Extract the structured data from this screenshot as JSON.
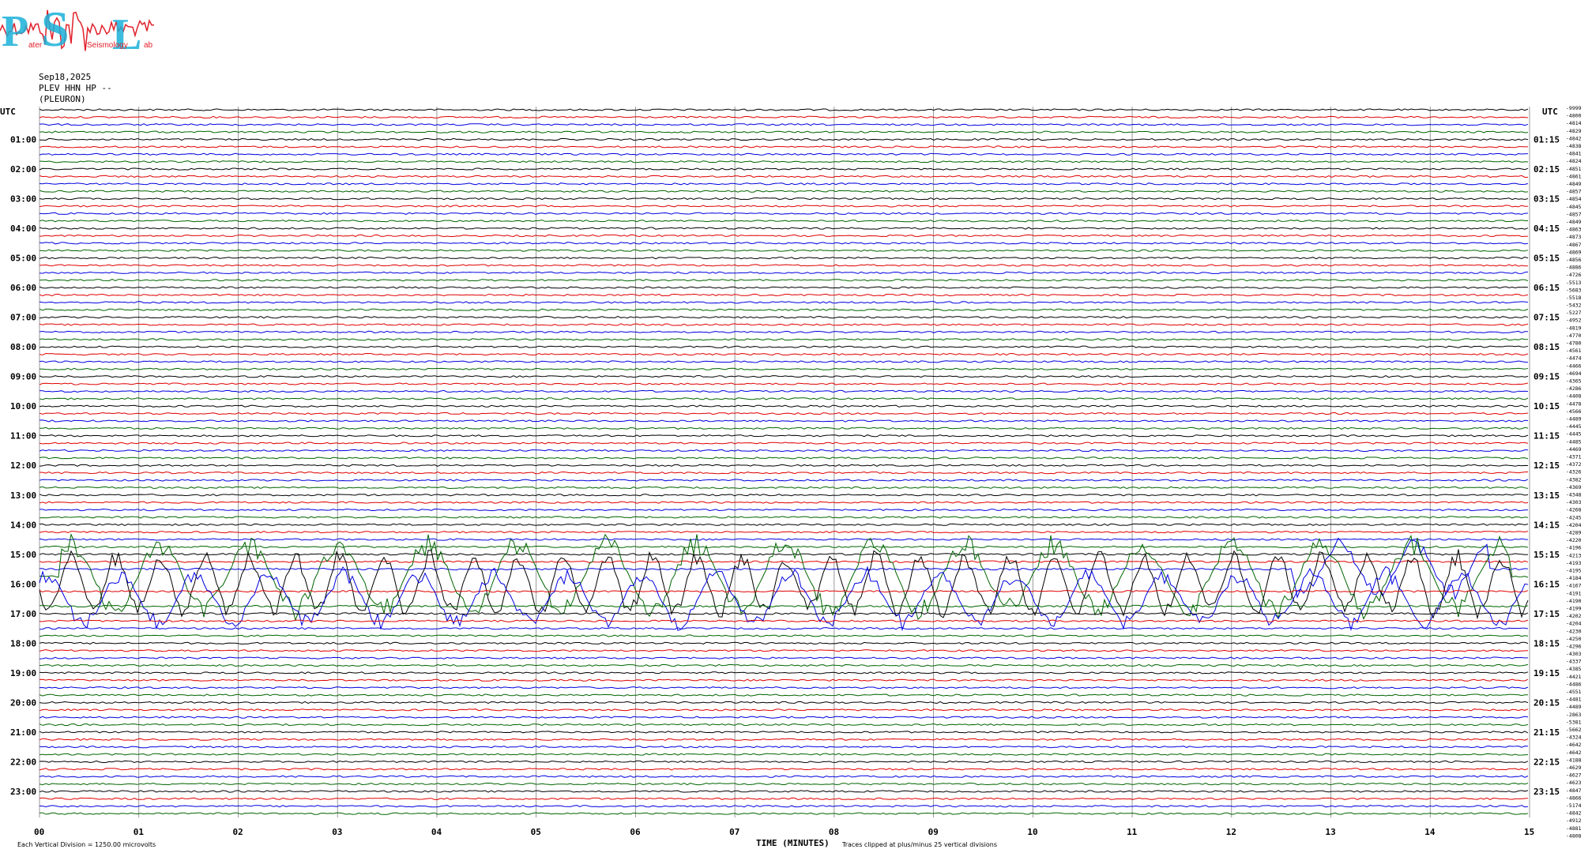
{
  "logo": {
    "letters": [
      "P",
      "S",
      "L"
    ],
    "small_words": [
      "ater",
      "Seismology",
      "ab"
    ]
  },
  "header": {
    "date": "Sep18,2025",
    "station": "PLEV HHN HP --",
    "location": "(PLEURON)"
  },
  "colors": {
    "trace_cycle": [
      "#000000",
      "#e00000",
      "#0000e0",
      "#006400"
    ],
    "grid": "#808080",
    "logo_red": "#e0202a",
    "logo_cyan": "#1ab0d8"
  },
  "chart_data": {
    "type": "line",
    "title": "Sep18,2025 PLEV HHN HP -- (PLEURON)",
    "xlabel": "TIME (MINUTES)",
    "ylabel_left": "UTC",
    "ylabel_right": "UTC",
    "x_ticks": [
      "00",
      "01",
      "02",
      "03",
      "04",
      "05",
      "06",
      "07",
      "08",
      "09",
      "10",
      "11",
      "12",
      "13",
      "14",
      "15"
    ],
    "xlim": [
      0,
      15
    ],
    "trace_minutes": 15,
    "trace_count": 96,
    "left_time_labels": [
      "01:00",
      "02:00",
      "03:00",
      "04:00",
      "05:00",
      "06:00",
      "07:00",
      "08:00",
      "09:00",
      "10:00",
      "11:00",
      "12:00",
      "13:00",
      "14:00",
      "15:00",
      "16:00",
      "17:00",
      "18:00",
      "19:00",
      "20:00",
      "21:00",
      "22:00",
      "23:00"
    ],
    "right_time_labels": [
      "01:15",
      "02:15",
      "03:15",
      "04:15",
      "05:15",
      "06:15",
      "07:15",
      "08:15",
      "09:15",
      "10:15",
      "11:15",
      "12:15",
      "13:15",
      "14:15",
      "15:15",
      "16:15",
      "17:15",
      "18:15",
      "19:15",
      "20:15",
      "21:15",
      "22:15",
      "23:15"
    ],
    "trace_offsets": [
      "-9999",
      "-4800",
      "-4814",
      "-4829",
      "-4842",
      "-4838",
      "-4841",
      "-4824",
      "-4851",
      "-4861",
      "-4849",
      "-4857",
      "-4854",
      "-4845",
      "-4857",
      "-4849",
      "-4863",
      "-4873",
      "-4867",
      "-4869",
      "-4856",
      "-4886",
      "-4726",
      "-5513",
      "-5683",
      "-5518",
      "-5432",
      "-5227",
      "-4952",
      "-4819",
      "-4770",
      "-4780",
      "-4561",
      "-4474",
      "-4466",
      "-4694",
      "-4365",
      "-4286",
      "-4408",
      "-4478",
      "-4566",
      "-4489",
      "-4445",
      "-4445",
      "-4485",
      "-4469",
      "-4371",
      "-4372",
      "-4326",
      "-4382",
      "-4369",
      "-4348",
      "-4303",
      "-4268",
      "-4245",
      "-4204",
      "-4289",
      "-4220",
      "-4196",
      "-4213",
      "-4193",
      "-4195",
      "-4184",
      "-4167",
      "-4191",
      "-4190",
      "-4199",
      "-4202",
      "-4204",
      "-4230",
      "-4250",
      "-4296",
      "-4303",
      "-4337",
      "-4385",
      "-4421",
      "-4486",
      "-4551",
      "-4481",
      "-4489",
      "-2863",
      "-5381",
      "-5662",
      "-4324",
      "-4642",
      "-4642",
      "-4188",
      "-4629",
      "-4627",
      "-4623",
      "-4847",
      "-4866",
      "-5174",
      "-4842",
      "-4912",
      "-4881",
      "-4808"
    ],
    "events": [
      {
        "trace": 62,
        "start_min": 12.6,
        "end_min": 14.6,
        "amp": 40
      },
      {
        "trace": 63,
        "start_min": 0.2,
        "end_min": 14.8,
        "amp": 55
      },
      {
        "trace": 64,
        "start_min": 0.0,
        "end_min": 15.0,
        "amp": 45
      },
      {
        "trace": 66,
        "start_min": 0.0,
        "end_min": 15.0,
        "amp": 40
      }
    ],
    "footnotes": {
      "vertical_division": "Each Vertical Division = 1250.00 microvolts",
      "clipping": "Traces clipped at plus/minus 25 vertical divisions"
    }
  }
}
